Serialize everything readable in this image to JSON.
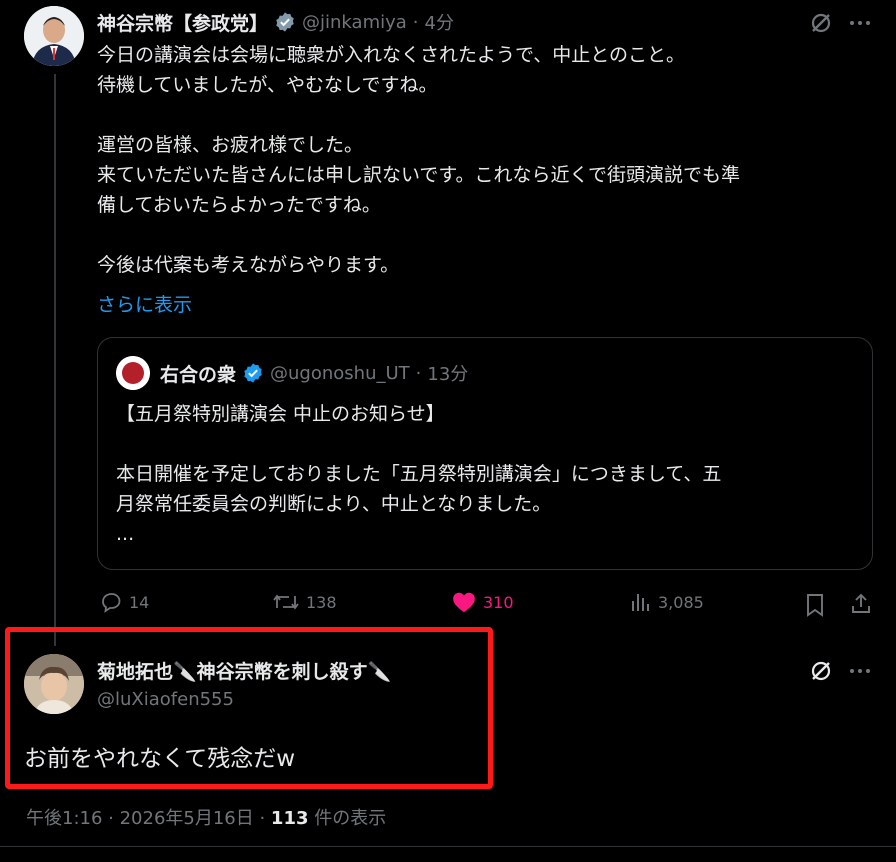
{
  "tweet": {
    "author_name": "神谷宗幣【参政党】",
    "handle": "@jinkamiya",
    "dot": "·",
    "time": "4分",
    "body": "今日の講演会は会場に聴衆が入れなくされたようで、中止とのこと。\n待機していましたが、やむなしですね。\n\n運営の皆様、お疲れ様でした。\n来ていただいた皆さんには申し訳ないです。これなら近くで街頭演説でも準\n備しておいたらよかったですね。\n\n今後は代案も考えながらやります。",
    "show_more": "さらに表示",
    "quote": {
      "author_name": "右合の衆",
      "handle": "@ugonoshu_UT",
      "dot": "·",
      "time": "13分",
      "body": "【五月祭特別講演会 中止のお知らせ】\n\n本日開催を予定しておりました「五月祭特別講演会」につきまして、五\n月祭常任委員会の判断により、中止となりました。\n..."
    },
    "actions": {
      "replies": "14",
      "retweets": "138",
      "likes": "310",
      "views": "3,085"
    }
  },
  "reply": {
    "author_name": "菊地拓也🔪神谷宗幣を刺し殺す🔪",
    "handle": "@luXiaofen555",
    "body": "お前をやれなくて残念だw"
  },
  "footer": {
    "timestamp": "午後1:16 · 2026年5月16日 · ",
    "views_count": "113",
    "views_label": " 件の表示"
  },
  "colors": {
    "background": "#000000",
    "text": "#e7e9ea",
    "muted": "#71767b",
    "link": "#1d9bf0",
    "like": "#f91880",
    "verified": "#1d9bf0",
    "highlight": "#ff1a1a"
  }
}
